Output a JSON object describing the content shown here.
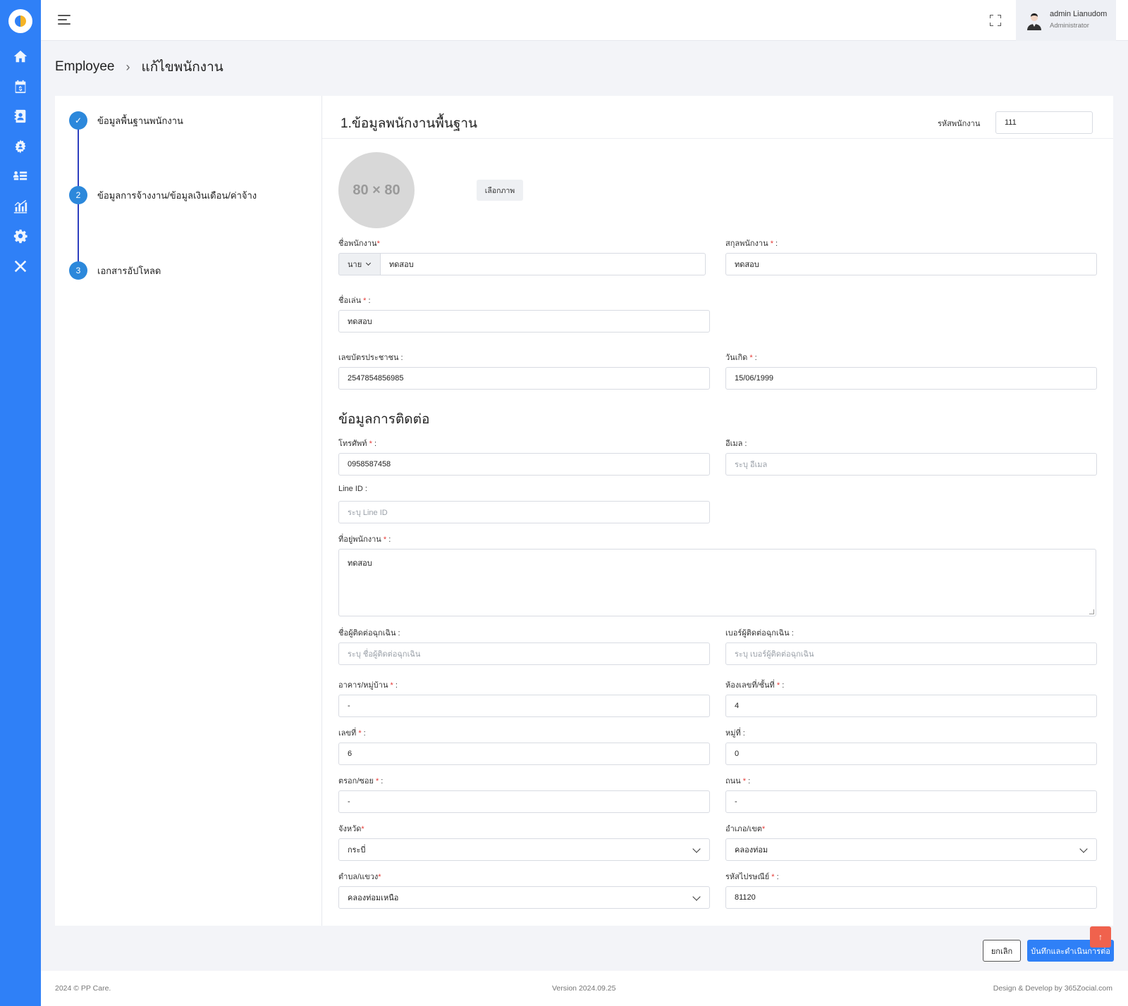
{
  "sidebar": {
    "items": [
      {
        "icon": "home-icon"
      },
      {
        "icon": "payroll-calendar-icon"
      },
      {
        "icon": "contact-book-icon"
      },
      {
        "icon": "employee-group-icon"
      },
      {
        "icon": "list-icon"
      },
      {
        "icon": "report-chart-icon"
      },
      {
        "icon": "settings-gear-icon"
      },
      {
        "icon": "tools-icon"
      }
    ]
  },
  "header": {
    "user_name": "admin Lianudom",
    "user_role": "Administrator"
  },
  "breadcrumb": {
    "parent": "Employee",
    "current": "แก้ไขพนักงาน"
  },
  "steps": [
    {
      "marker": "✓",
      "label": "ข้อมูลพื้นฐานพนักงาน"
    },
    {
      "marker": "2",
      "label": "ข้อมูลการจ้างงาน/ข้อมูลเงินเดือน/ค่าจ้าง"
    },
    {
      "marker": "3",
      "label": "เอกสารอัปโหลด"
    }
  ],
  "form": {
    "title": "1.ข้อมูลพนักงานพื้นฐาน",
    "employee_code_label": "รหัสพนักงาน",
    "employee_code": "111",
    "photo_placeholder": "80 × 80",
    "choose_image_label": "เลือกภาพ",
    "first_name_label": "ชื่อพนักงาน",
    "name_prefix": "นาย",
    "first_name": "ทดสอบ",
    "last_name_label": "สกุลพนักงาน",
    "last_name": "ทดสอบ",
    "nickname_label": "ชื่อเล่น",
    "nickname": "ทดสอบ",
    "id_card_label": "เลขบัตรประชาชน :",
    "id_card": "2547854856985",
    "birthdate_label": "วันเกิด",
    "birthdate": "15/06/1999",
    "contact_section_title": "ข้อมูลการติดต่อ",
    "phone_label": "โทรศัพท์",
    "phone": "0958587458",
    "email_label": "อีเมล :",
    "email_placeholder": "ระบุ อีเมล",
    "line_label": "Line ID :",
    "line_placeholder": "ระบุ Line ID",
    "address_label": "ที่อยู่พนักงาน",
    "address": "ทดสอบ",
    "emergency_name_label": "ชื่อผู้ติดต่อฉุกเฉิน :",
    "emergency_name_placeholder": "ระบุ ชื่อผู้ติดต่อฉุกเฉิน",
    "emergency_phone_label": "เบอร์ผู้ติดต่อฉุกเฉิน :",
    "emergency_phone_placeholder": "ระบุ เบอร์ผู้ติดต่อฉุกเฉิน",
    "building_label": "อาคาร/หมู่บ้าน",
    "building": "-",
    "room_label": "ห้องเลขที่/ชั้นที่",
    "room": "4",
    "house_no_label": "เลขที่",
    "house_no": "6",
    "moo_label": "หมู่ที่ :",
    "moo": "0",
    "alley_label": "ตรอก/ซอย",
    "alley": "-",
    "road_label": "ถนน",
    "road": "-",
    "province_label": "จังหวัด",
    "province": "กระบี่",
    "district_label": "อำเภอ/เขต",
    "district": "คลองท่อม",
    "subdistrict_label": "ตำบล/แขวง",
    "subdistrict": "คลองท่อมเหนือ",
    "postcode_label": "รหัสไปรษณีย์",
    "postcode": "81120"
  },
  "actions": {
    "cancel_label": "ยกเลิก",
    "save_label": "บันทึกและดำเนินการต่อ",
    "scroll_top_icon": "↑"
  },
  "footer": {
    "copyright": "2024 © PP Care.",
    "version": "Version 2024.09.25",
    "credit": "Design & Develop by 365Zocial.com"
  },
  "colors": {
    "sidebar": "#2f80f7",
    "step": "#2c88db",
    "required": "#e53935",
    "scroll_top": "#f0624d"
  }
}
